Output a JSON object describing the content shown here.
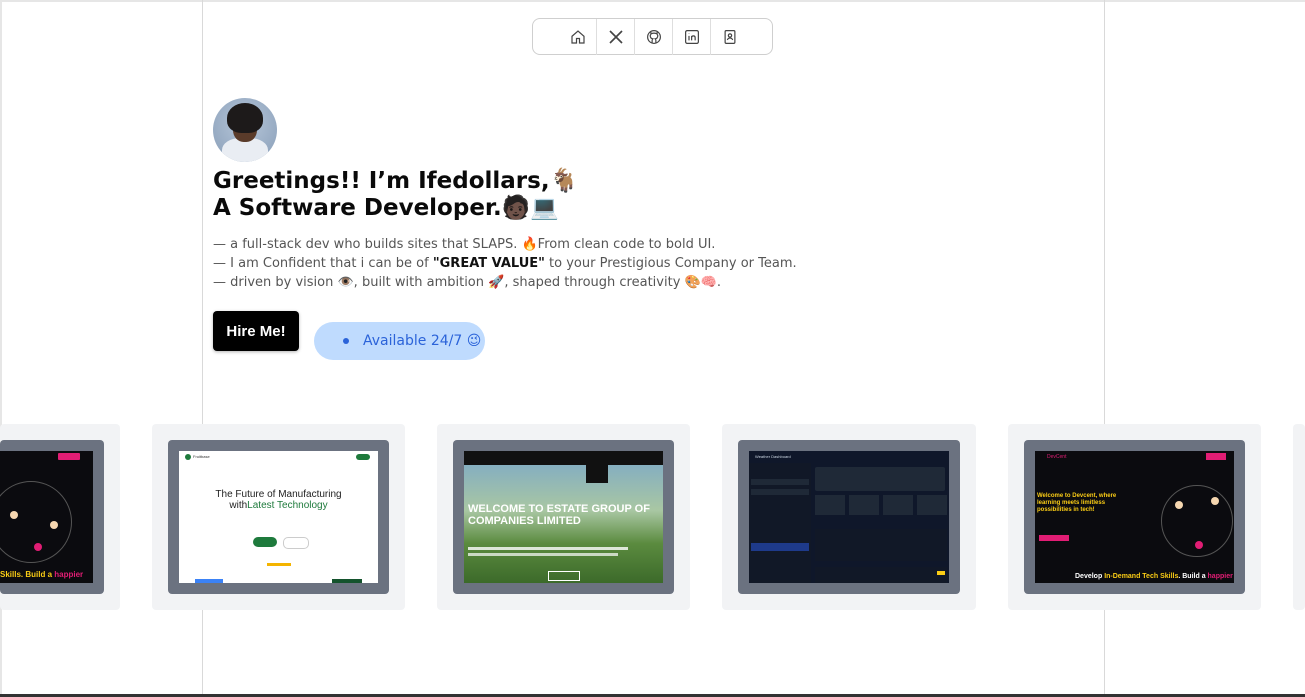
{
  "nav": {
    "items": [
      {
        "icon": "home-icon"
      },
      {
        "icon": "x-logo-icon"
      },
      {
        "icon": "github-icon"
      },
      {
        "icon": "linkedin-icon"
      },
      {
        "icon": "contact-card-icon"
      }
    ]
  },
  "hero": {
    "headline_line1": "Greetings!! I’m Ifedollars,🐐",
    "headline_line2": "A Software Developer.🧑🏿💻",
    "bio_line1": "— a full-stack dev who builds sites that SLAPS. 🔥From clean code to bold UI.",
    "bio_line2_pre": "— I am Confident that i can be of ",
    "bio_line2_bold": "\"GREAT VALUE\"",
    "bio_line2_post": " to your Prestigious Company or Team.",
    "bio_line3": "— driven by vision 👁️, built with ambition 🚀, shaped through creativity 🎨🧠.",
    "hire_label": "Hire Me!",
    "available_label": "Available 24/7 😉"
  },
  "projects": [
    {
      "theme": "dark",
      "footer_pre": "Skills. Build a ",
      "footer_accent": "happier",
      "accent_color": "#e11d74"
    },
    {
      "theme": "light",
      "brand": "Fruitbase",
      "title_line1": "The Future of Manufacturing",
      "title_line2_pre": "with",
      "title_line2_accent": "Latest Technology",
      "accent_color": "#1e7a3c"
    },
    {
      "theme": "green",
      "title_line1": "WELCOME TO ESTATE GROUP OF",
      "title_line2": "COMPANIES LIMITED",
      "accent_color": "#ffffff"
    },
    {
      "theme": "dashboard",
      "brand": "Weather Dashboard",
      "accent_color": "#2563eb"
    },
    {
      "theme": "dark",
      "brand": "DevCent",
      "title": "Welcome to Devcent, where learning meets limitless possibilities in tech!",
      "footer_pre": "Develop ",
      "footer_accent": "In-Demand Tech Skills",
      "footer_post": ". Build a ",
      "footer_accent2": "happier",
      "accent_color": "#facc15"
    }
  ]
}
